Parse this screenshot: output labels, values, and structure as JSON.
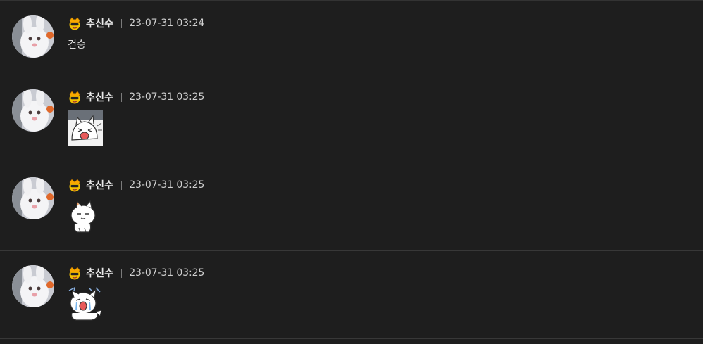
{
  "comments": [
    {
      "author": "추신수",
      "timestamp": "23-07-31 03:24",
      "text": "건승",
      "sticker": null,
      "avatar_icon": "white-bunny-avatar-icon",
      "badge_icon": "level-crown-badge-icon"
    },
    {
      "author": "추신수",
      "timestamp": "23-07-31 03:25",
      "text": "",
      "sticker": "screaming-cat-sticker-icon",
      "avatar_icon": "white-bunny-avatar-icon",
      "badge_icon": "level-crown-badge-icon"
    },
    {
      "author": "추신수",
      "timestamp": "23-07-31 03:25",
      "text": "",
      "sticker": "smug-cat-sticker-icon",
      "avatar_icon": "white-bunny-avatar-icon",
      "badge_icon": "level-crown-badge-icon"
    },
    {
      "author": "추신수",
      "timestamp": "23-07-31 03:25",
      "text": "",
      "sticker": "crying-cat-sticker-icon",
      "avatar_icon": "white-bunny-avatar-icon",
      "badge_icon": "level-crown-badge-icon"
    }
  ],
  "colors": {
    "background": "#1e1e1e",
    "divider": "#383838",
    "author_text": "#e8e8e8",
    "meta_text": "#cfcfcf"
  }
}
